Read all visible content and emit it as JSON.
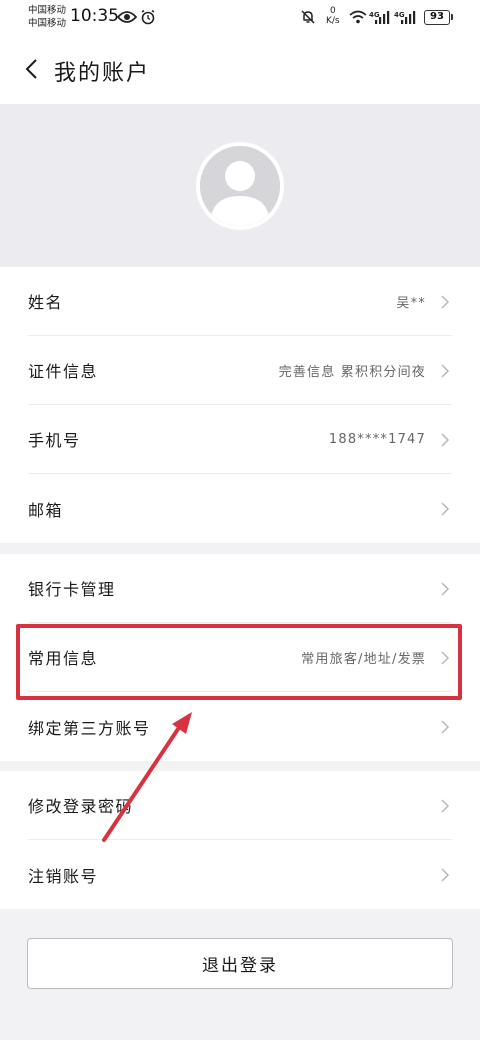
{
  "status_bar": {
    "carrier_1": "中国移动",
    "carrier_2": "中国移动",
    "time": "10:35",
    "net_speed_value": "0",
    "net_speed_unit": "K/s",
    "signal_1_label": "4G",
    "signal_2_label": "4G",
    "battery": "93"
  },
  "header": {
    "title": "我的账户"
  },
  "profile_group": [
    {
      "label": "姓名",
      "value": "吴**"
    },
    {
      "label": "证件信息",
      "value": "完善信息 累积积分间夜"
    },
    {
      "label": "手机号",
      "value": "188****1747"
    },
    {
      "label": "邮箱",
      "value": ""
    }
  ],
  "services_group": [
    {
      "label": "银行卡管理",
      "value": ""
    },
    {
      "label": "常用信息",
      "value": "常用旅客/地址/发票"
    },
    {
      "label": "绑定第三方账号",
      "value": ""
    }
  ],
  "security_group": [
    {
      "label": "修改登录密码",
      "value": ""
    },
    {
      "label": "注销账号",
      "value": ""
    }
  ],
  "logout_label": "退出登录",
  "annotation": {
    "highlight_color": "#d8323f",
    "arrow_color": "#d8323f"
  }
}
